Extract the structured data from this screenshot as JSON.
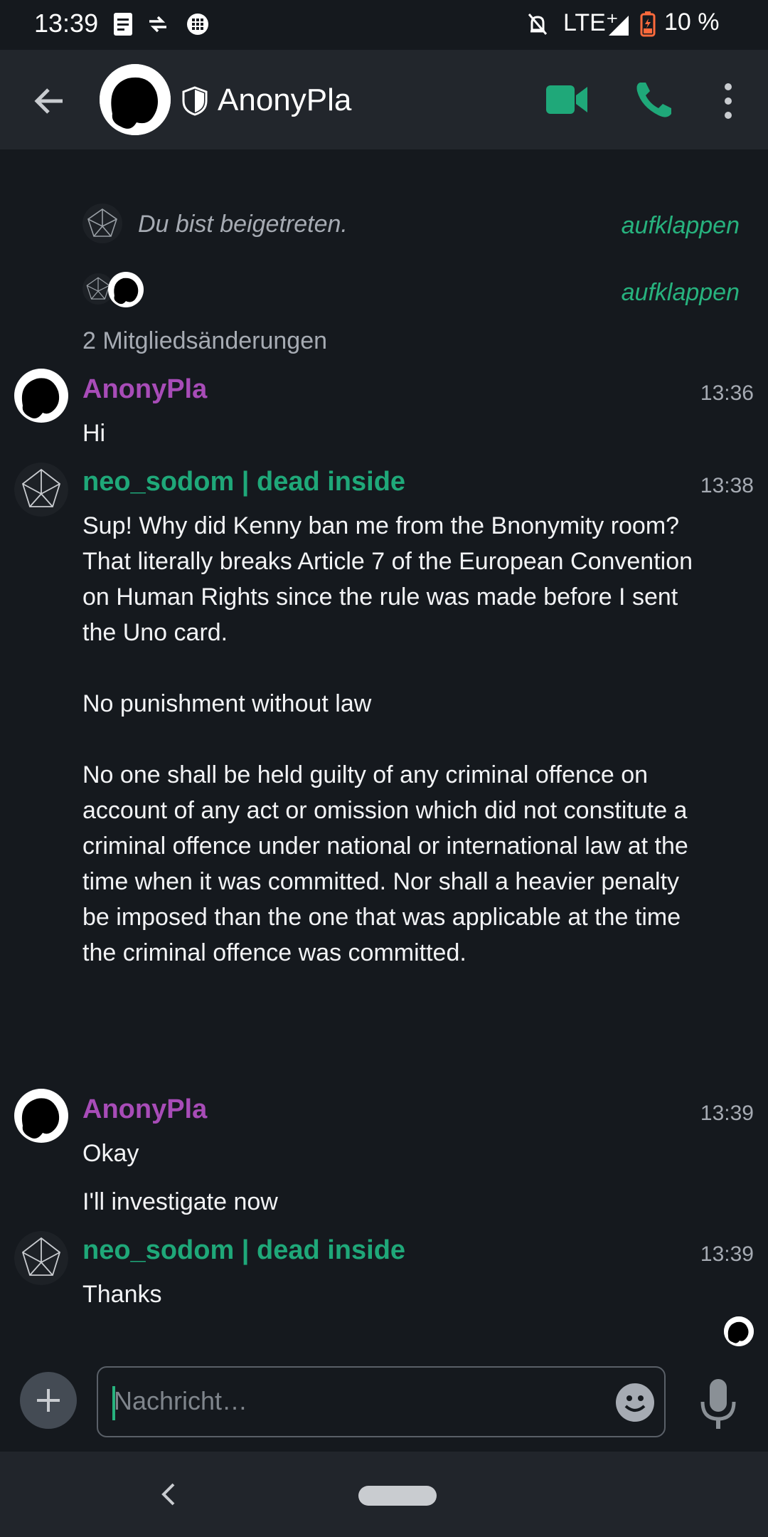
{
  "status_bar": {
    "time": "13:39",
    "network": "LTE⁺",
    "battery": "10 %",
    "icons": [
      "notification-icon",
      "data-transfer-icon",
      "app-icon",
      "mute-icon",
      "signal-icon",
      "battery-icon"
    ]
  },
  "header": {
    "title": "AnonyPla",
    "icons": [
      "back-arrow-icon",
      "avatar",
      "shield-icon",
      "video-call-icon",
      "phone-icon",
      "more-vert-icon"
    ],
    "accent_color": "#1fa879"
  },
  "system_events": [
    {
      "text": "Du bist beigetreten.",
      "action": "aufklappen"
    },
    {
      "text": "2 Mitgliedsänderungen",
      "action": "aufklappen"
    }
  ],
  "messages": [
    {
      "sender": "AnonyPla",
      "time": "13:36",
      "lines": [
        "Hi"
      ]
    },
    {
      "sender": "neo_sodom | dead inside",
      "time": "13:38",
      "paragraphs": [
        "Sup! Why did Kenny ban me from the Bnonymity room? That literally breaks Article 7 of the European Convention on Human Rights since the rule was made before I sent the Uno card.",
        "No punishment without law",
        "No one shall be held guilty of any criminal offence on account of any act or omission which did not constitute a criminal offence under national or international law at the time when it was committed. Nor shall a heavier penalty be imposed than the one that was applicable at the time the criminal offence was committed."
      ]
    },
    {
      "sender": "AnonyPla",
      "time": "13:39",
      "lines": [
        "Okay",
        "I'll investigate now"
      ]
    },
    {
      "sender": "neo_sodom | dead inside",
      "time": "13:39",
      "lines": [
        "Thanks"
      ]
    }
  ],
  "composer": {
    "placeholder": "Nachricht…"
  },
  "colors": {
    "sender_anonypla": "#a84cb8",
    "sender_neo": "#1fa879",
    "background": "#15191e"
  }
}
